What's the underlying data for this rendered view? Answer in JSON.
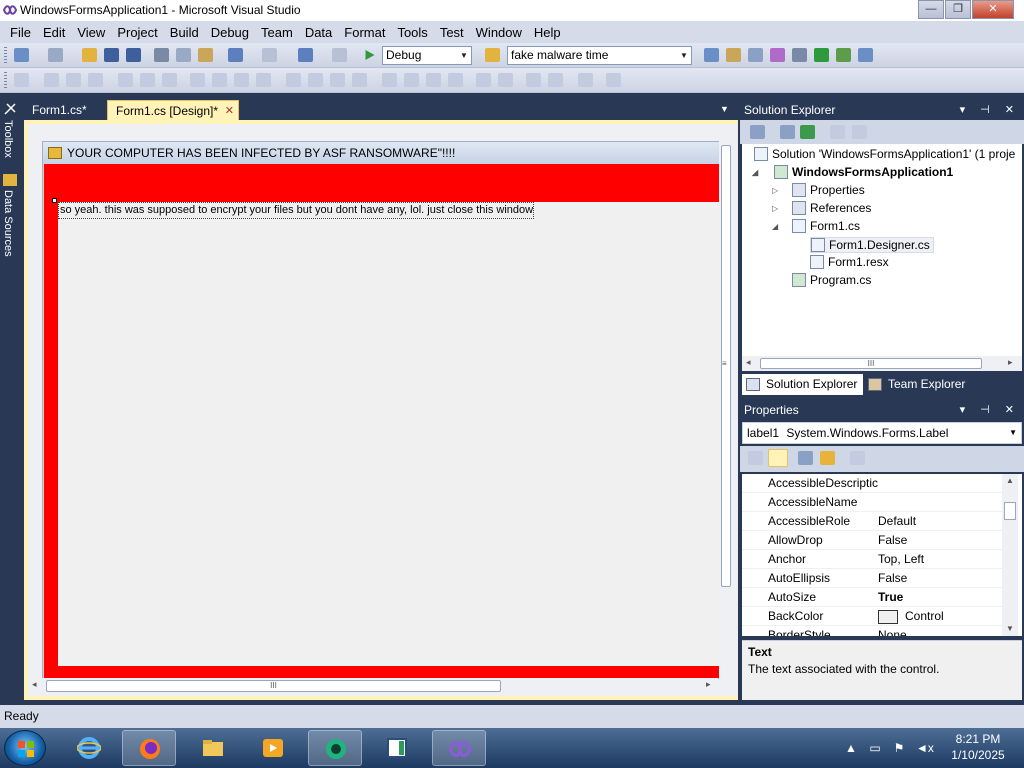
{
  "window": {
    "title": "WindowsFormsApplication1 - Microsoft Visual Studio",
    "controls": {
      "minimize": "—",
      "maximize": "❐",
      "close": "✕"
    }
  },
  "menu": [
    "File",
    "Edit",
    "View",
    "Project",
    "Build",
    "Debug",
    "Team",
    "Data",
    "Format",
    "Tools",
    "Test",
    "Window",
    "Help"
  ],
  "toolbar": {
    "config_value": "Debug",
    "search_value": "fake malware time"
  },
  "side_tabs": [
    "Toolbox",
    "Data Sources"
  ],
  "doc_tabs": [
    {
      "label": "Form1.cs*",
      "active": false
    },
    {
      "label": "Form1.cs [Design]*",
      "active": true,
      "close": "✕"
    }
  ],
  "designer": {
    "form_title": "YOUR COMPUTER HAS BEEN INFECTED BY ASF RANSOMWARE\"!!!!",
    "label_text": "so yeah. this was supposed to encrypt your files but you dont have any, lol. just close this window ig",
    "scroll_grip": "III"
  },
  "solution_explorer": {
    "title": "Solution Explorer",
    "header_controls": "▾ ⊣ ✕",
    "items": [
      {
        "label": "Solution 'WindowsFormsApplication1' (1 proje",
        "bold": false
      },
      {
        "label": "WindowsFormsApplication1",
        "bold": true
      },
      {
        "label": "Properties",
        "bold": false
      },
      {
        "label": "References",
        "bold": false
      },
      {
        "label": "Form1.cs",
        "bold": false
      },
      {
        "label": "Form1.Designer.cs",
        "bold": false
      },
      {
        "label": "Form1.resx",
        "bold": false
      },
      {
        "label": "Program.cs",
        "bold": false
      }
    ],
    "tabs": [
      "Solution Explorer",
      "Team Explorer"
    ]
  },
  "properties": {
    "title": "Properties",
    "header_controls": "▾ ⊣ ✕",
    "object_name": "label1",
    "object_type": "System.Windows.Forms.Label",
    "rows": [
      {
        "name": "AccessibleDescriptic",
        "value": "",
        "bold": false
      },
      {
        "name": "AccessibleName",
        "value": "",
        "bold": false
      },
      {
        "name": "AccessibleRole",
        "value": "Default",
        "bold": false
      },
      {
        "name": "AllowDrop",
        "value": "False",
        "bold": false
      },
      {
        "name": "Anchor",
        "value": "Top, Left",
        "bold": false
      },
      {
        "name": "AutoEllipsis",
        "value": "False",
        "bold": false
      },
      {
        "name": "AutoSize",
        "value": "True",
        "bold": true
      },
      {
        "name": "BackColor",
        "value": "Control",
        "bold": false
      },
      {
        "name": "BorderStyle",
        "value": "None",
        "bold": false
      }
    ],
    "desc_title": "Text",
    "desc_text": "The text associated with the control."
  },
  "status": {
    "text": "Ready"
  },
  "taskbar": {
    "apps": [
      "internet-explorer",
      "firefox",
      "file-explorer",
      "media-player",
      "gaming-app",
      "notepad-app",
      "visual-studio"
    ],
    "time": "8:21 PM",
    "date": "1/10/2025"
  },
  "colors": {
    "ransom_red": "#ff0000",
    "vs_dark": "#293955",
    "designer_gold": "#fff3b8"
  }
}
